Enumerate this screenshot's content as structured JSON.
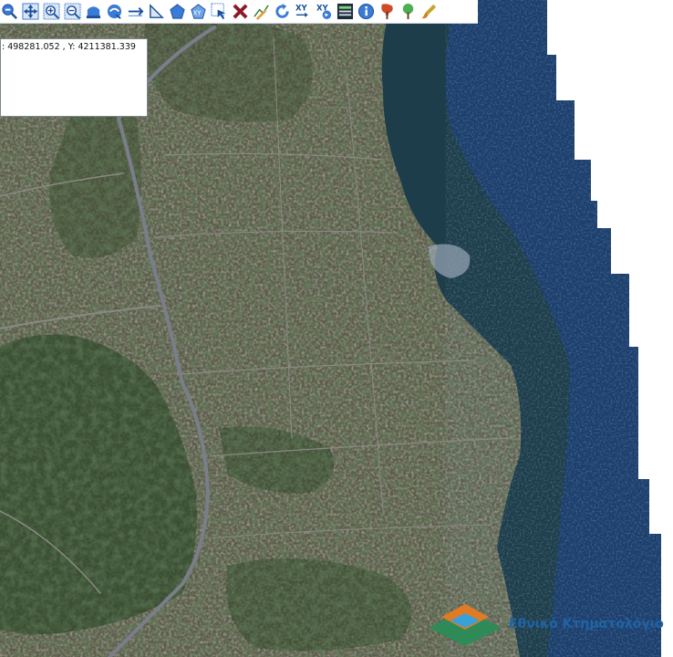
{
  "toolbar": {
    "tools": [
      {
        "name": "zoom-out-icon"
      },
      {
        "name": "pan-icon"
      },
      {
        "name": "zoom-in-box-icon"
      },
      {
        "name": "zoom-out-box-icon"
      },
      {
        "name": "previous-extent-icon"
      },
      {
        "name": "next-extent-icon"
      },
      {
        "name": "measure-distance-icon"
      },
      {
        "name": "measure-area-icon"
      },
      {
        "name": "draw-polygon-icon"
      },
      {
        "name": "xy-polygon-icon"
      },
      {
        "name": "select-arrow-icon"
      },
      {
        "name": "clear-icon"
      },
      {
        "name": "edit-vertex-icon"
      },
      {
        "name": "refresh-icon"
      },
      {
        "name": "xy-input-icon"
      },
      {
        "name": "xy-goto-icon"
      },
      {
        "name": "layers-table-icon"
      },
      {
        "name": "info-icon"
      },
      {
        "name": "land-marker-icon"
      },
      {
        "name": "tree-marker-icon"
      },
      {
        "name": "brush-icon"
      }
    ]
  },
  "coordinates": {
    "text": ": 498281.052 , Y: 4211381.339"
  },
  "logo": {
    "text": "Εθνικό Κτηματολόγιο"
  },
  "colors": {
    "sea_deep": "#1c3e6c",
    "sea_shallow": "#26486a",
    "vegetation": "#2f4a2a",
    "urban": "#6d6a5c",
    "road": "#7a7e8a",
    "logo_blue": "#1f64a6",
    "logo_green": "#2e8b57",
    "logo_orange": "#e07b24"
  }
}
